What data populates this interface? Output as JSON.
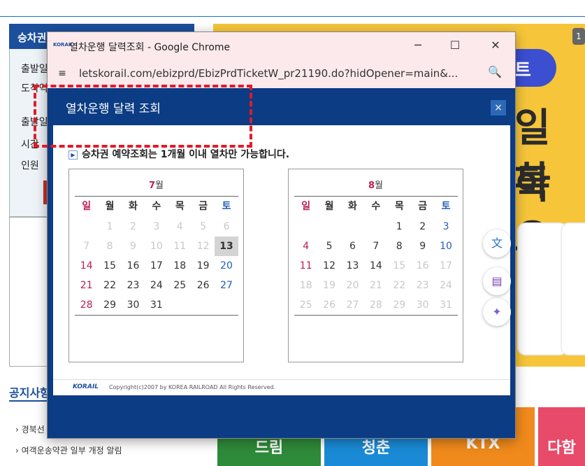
{
  "background": {
    "left_panel_title": "승차권",
    "left_rows": [
      "출발일",
      "도착역",
      "출발일",
      "시간",
      "인원"
    ],
    "banner_text_1": "일툭",
    "banner_text_2": "하요",
    "banner_pill": "트",
    "banner_badge": "1",
    "notice_title": "공지사항",
    "news": [
      "경북선",
      "여객운송약관 일부 개정 알림"
    ],
    "tiles": [
      {
        "label": "드림",
        "color": "#2e8b3a"
      },
      {
        "label": "청춘",
        "color": "#1a8ad6"
      },
      {
        "label": "KTX",
        "color": "#f08a1c"
      },
      {
        "label": "다함",
        "color": "#e84a6a"
      }
    ]
  },
  "window": {
    "logo": "KORAIL",
    "title": "열차운행 달력조회 - Google Chrome",
    "minimize": "─",
    "maximize": "☐",
    "close": "✕",
    "site_info_icon": "≡",
    "url": "letskorail.com/ebizprd/EbizPrdTicketW_pr21190.do?hidOpener=main&...",
    "zoom_icon": "🔍"
  },
  "dialog": {
    "title": "열차운행 달력 조회",
    "close": "×",
    "notice": "승차권 예약조회는 1개월 이내 열차만 가능합니다.",
    "weekdays": [
      "일",
      "월",
      "화",
      "수",
      "목",
      "금",
      "토"
    ],
    "footer_logo": "KORAIL",
    "footer_copy": "Copyright(c)2007 by KOREA RAILROAD All Rights Reserved."
  },
  "calendars": [
    {
      "month_num": "7",
      "month_suffix": "월",
      "weeks": [
        [
          {
            "d": ""
          },
          {
            "d": "1",
            "s": "dis"
          },
          {
            "d": "2",
            "s": "dis"
          },
          {
            "d": "3",
            "s": "dis"
          },
          {
            "d": "4",
            "s": "dis"
          },
          {
            "d": "5",
            "s": "dis"
          },
          {
            "d": "6",
            "s": "dis"
          }
        ],
        [
          {
            "d": "7",
            "s": "dis"
          },
          {
            "d": "8",
            "s": "dis"
          },
          {
            "d": "9",
            "s": "dis"
          },
          {
            "d": "10",
            "s": "dis"
          },
          {
            "d": "11",
            "s": "dis"
          },
          {
            "d": "12",
            "s": "dis"
          },
          {
            "d": "13",
            "s": "today"
          }
        ],
        [
          {
            "d": "14",
            "s": "sun"
          },
          {
            "d": "15"
          },
          {
            "d": "16"
          },
          {
            "d": "17"
          },
          {
            "d": "18"
          },
          {
            "d": "19"
          },
          {
            "d": "20",
            "s": "sat"
          }
        ],
        [
          {
            "d": "21",
            "s": "sun"
          },
          {
            "d": "22"
          },
          {
            "d": "23"
          },
          {
            "d": "24"
          },
          {
            "d": "25"
          },
          {
            "d": "26"
          },
          {
            "d": "27",
            "s": "sat"
          }
        ],
        [
          {
            "d": "28",
            "s": "sun"
          },
          {
            "d": "29"
          },
          {
            "d": "30"
          },
          {
            "d": "31"
          },
          {
            "d": ""
          },
          {
            "d": ""
          },
          {
            "d": ""
          }
        ]
      ]
    },
    {
      "month_num": "8",
      "month_suffix": "월",
      "weeks": [
        [
          {
            "d": ""
          },
          {
            "d": ""
          },
          {
            "d": ""
          },
          {
            "d": ""
          },
          {
            "d": "1"
          },
          {
            "d": "2"
          },
          {
            "d": "3",
            "s": "sat"
          }
        ],
        [
          {
            "d": "4",
            "s": "sun"
          },
          {
            "d": "5"
          },
          {
            "d": "6"
          },
          {
            "d": "7"
          },
          {
            "d": "8"
          },
          {
            "d": "9"
          },
          {
            "d": "10",
            "s": "sat"
          }
        ],
        [
          {
            "d": "11",
            "s": "sun"
          },
          {
            "d": "12"
          },
          {
            "d": "13"
          },
          {
            "d": "14"
          },
          {
            "d": "15",
            "s": "dis"
          },
          {
            "d": "16",
            "s": "dis"
          },
          {
            "d": "17",
            "s": "dis"
          }
        ],
        [
          {
            "d": "18",
            "s": "dis"
          },
          {
            "d": "19",
            "s": "dis"
          },
          {
            "d": "20",
            "s": "dis"
          },
          {
            "d": "21",
            "s": "dis"
          },
          {
            "d": "22",
            "s": "dis"
          },
          {
            "d": "23",
            "s": "dis"
          },
          {
            "d": "24",
            "s": "dis"
          }
        ],
        [
          {
            "d": "25",
            "s": "dis"
          },
          {
            "d": "26",
            "s": "dis"
          },
          {
            "d": "27",
            "s": "dis"
          },
          {
            "d": "28",
            "s": "dis"
          },
          {
            "d": "29",
            "s": "dis"
          },
          {
            "d": "30",
            "s": "dis"
          },
          {
            "d": "31",
            "s": "dis"
          }
        ]
      ]
    }
  ],
  "side_tools": [
    "translate-icon",
    "document-icon",
    "sparkle-icon"
  ]
}
